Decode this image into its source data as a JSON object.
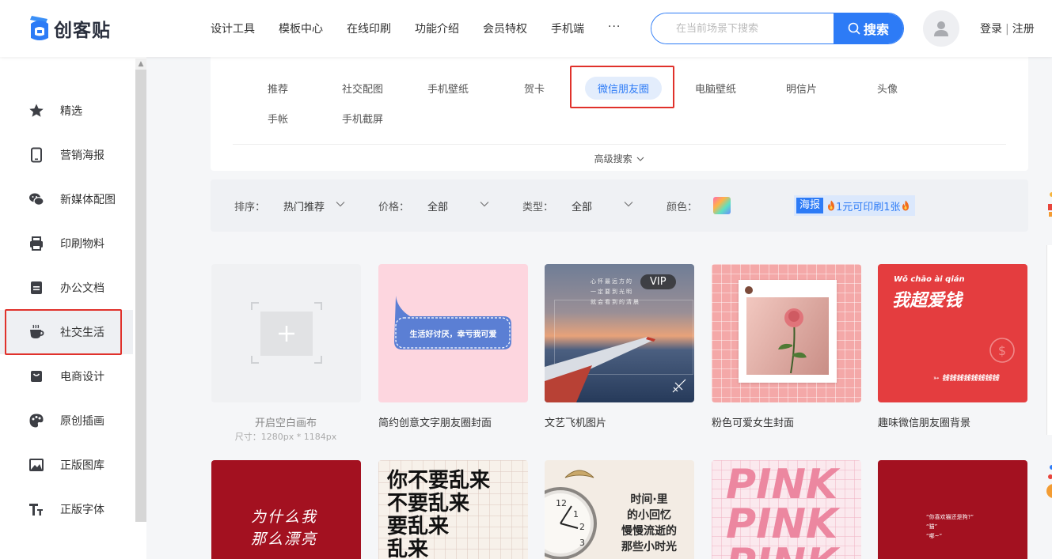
{
  "header": {
    "logo_text": "创客贴",
    "nav": [
      "设计工具",
      "模板中心",
      "在线印刷",
      "功能介绍",
      "会员特权",
      "手机端"
    ],
    "more": "···",
    "search_placeholder": "在当前场景下搜索",
    "search_button": "搜索",
    "login": "登录",
    "separator": "|",
    "register": "注册"
  },
  "sidebar": {
    "items": [
      {
        "label": "精选",
        "icon": "star-icon"
      },
      {
        "label": "营销海报",
        "icon": "phone-icon"
      },
      {
        "label": "新媒体配图",
        "icon": "wechat-icon"
      },
      {
        "label": "印刷物料",
        "icon": "printer-icon"
      },
      {
        "label": "办公文档",
        "icon": "document-icon"
      },
      {
        "label": "社交生活",
        "icon": "coffee-cup-icon"
      },
      {
        "label": "电商设计",
        "icon": "shopping-bag-icon"
      },
      {
        "label": "原创插画",
        "icon": "palette-icon"
      },
      {
        "label": "正版图库",
        "icon": "image-icon"
      },
      {
        "label": "正版字体",
        "icon": "font-icon"
      }
    ],
    "active_index": 5
  },
  "tags": {
    "row1": [
      "推荐",
      "社交配图",
      "手机壁纸",
      "贺卡",
      "微信朋友圈",
      "电脑壁纸",
      "明信片",
      "头像"
    ],
    "row2": [
      "手帐",
      "手机截屏"
    ],
    "active": "微信朋友圈",
    "advanced": "高级搜索"
  },
  "filters": {
    "sort_label": "排序：",
    "sort_value": "热门推荐",
    "price_label": "价格：",
    "price_value": "全部",
    "type_label": "类型：",
    "type_value": "全部",
    "color_label": "颜色：",
    "promo_badge": "海报",
    "promo_text": "1元可印刷1张"
  },
  "cards_row1": [
    {
      "title": "开启空白画布",
      "subtitle": "尺寸：1280px * 1184px"
    },
    {
      "title": "简约创意文字朋友圈封面",
      "inner_text": "生活好讨厌，幸亏我可爱"
    },
    {
      "title": "文艺飞机图片",
      "badge": "VIP",
      "inner_text": [
        "心怀最远方的",
        "一定要到光明",
        "就会看到的清晨"
      ]
    },
    {
      "title": "粉色可爱女生封面"
    },
    {
      "title": "趣味微信朋友圈背景",
      "pinyin": "Wǒ  chāo  ài  qián",
      "inner_text": "我超爱钱",
      "footer": "钱钱钱钱钱钱钱钱"
    }
  ],
  "cards_row2": [
    {
      "inner_text": [
        "为什么我",
        "那么漂亮"
      ]
    },
    {
      "inner_text": [
        "你不要乱来",
        "不要乱来",
        "要乱来",
        "乱来"
      ]
    },
    {
      "inner_text": [
        "时间·里",
        "的小回忆",
        "慢慢流逝的",
        "那些小时光"
      ]
    },
    {
      "inner_text": [
        "PINK",
        "PINK",
        "PINK"
      ]
    },
    {
      "inner_text": [
        "“你喜欢猫还是狗?”",
        "“猫”",
        "“哪~”"
      ]
    }
  ]
}
